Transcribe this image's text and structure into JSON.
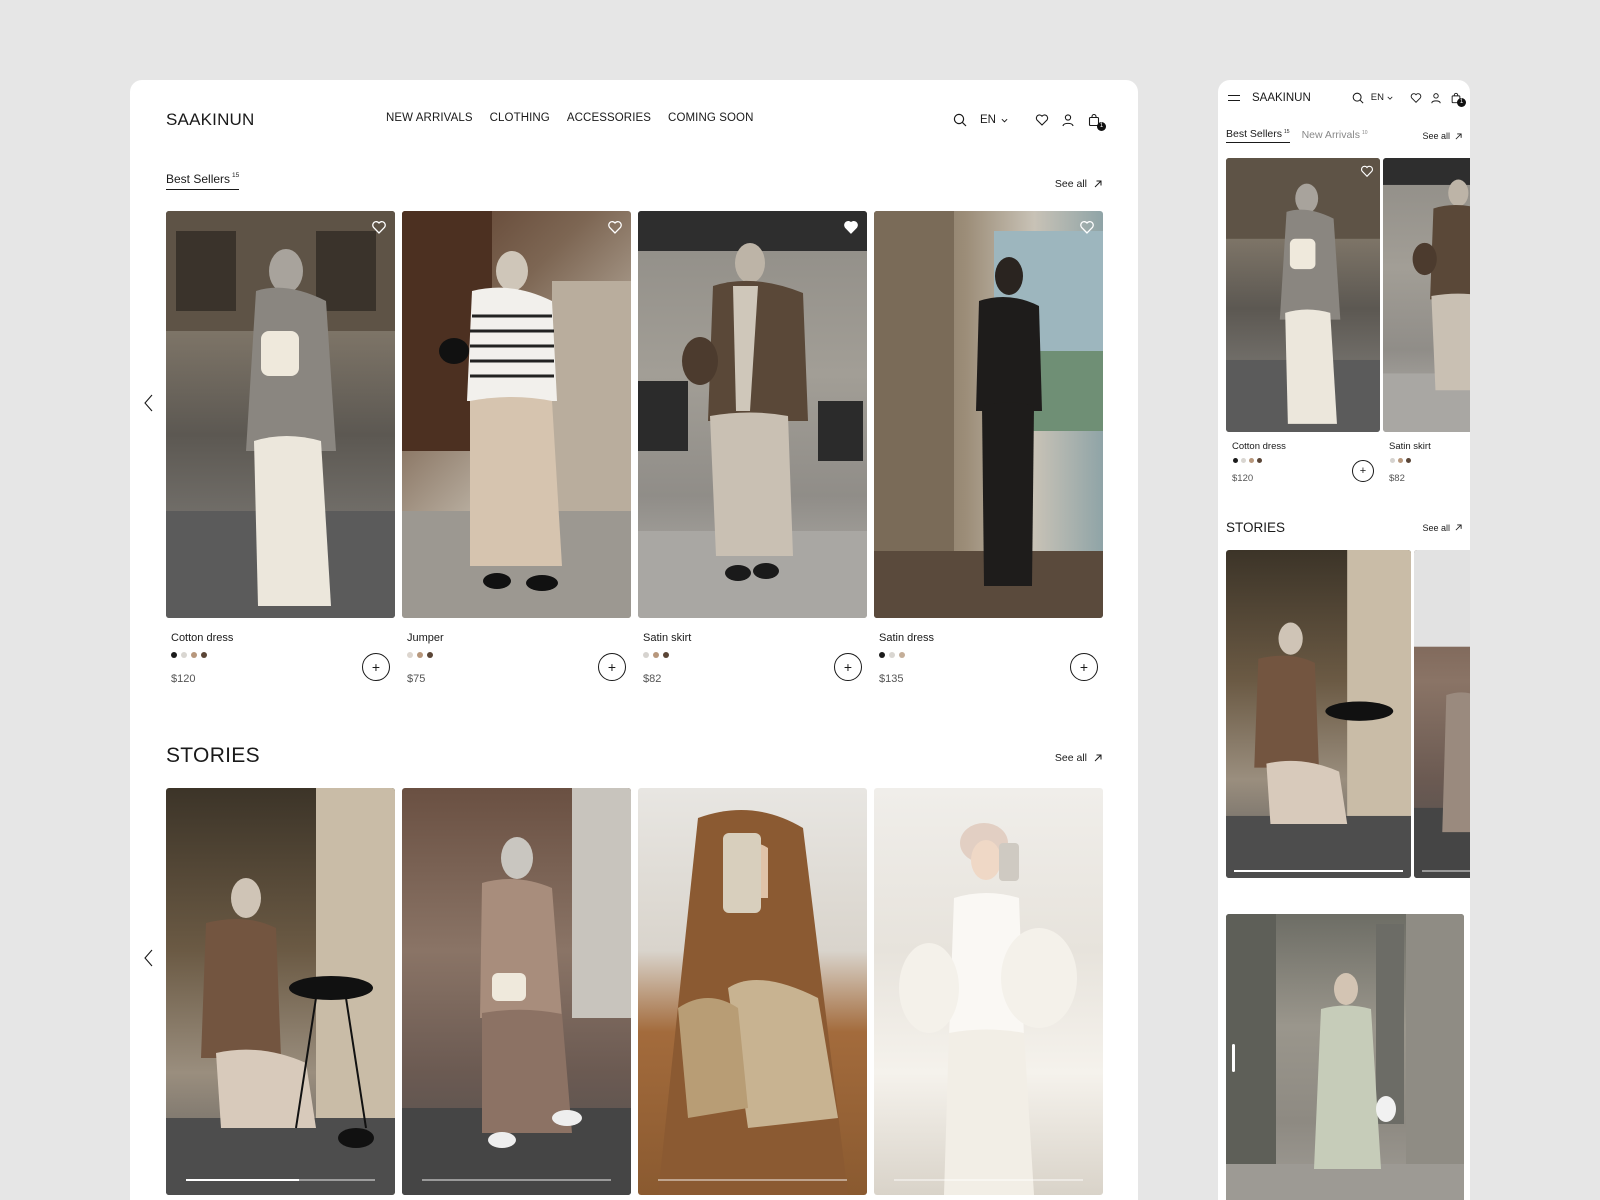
{
  "brand": "SAAKINUN",
  "nav": [
    "NEW ARRIVALS",
    "CLOTHING",
    "ACCESSORIES",
    "COMING SOON"
  ],
  "language": "EN",
  "cart_count": "1",
  "best_sellers": {
    "label": "Best Sellers",
    "count": "15",
    "see_all": "See all",
    "products": [
      {
        "name": "Cotton dress",
        "price": "$120",
        "swatches": [
          "#1b1b1b",
          "#d9d6d1",
          "#b7977c",
          "#5a4536"
        ]
      },
      {
        "name": "Jumper",
        "price": "$75",
        "swatches": [
          "#ddd6cf",
          "#b7977c",
          "#5a4536"
        ]
      },
      {
        "name": "Satin skirt",
        "price": "$82",
        "swatches": [
          "#d6d3cf",
          "#b7977c",
          "#5a4536"
        ]
      },
      {
        "name": "Satin dress",
        "price": "$135",
        "swatches": [
          "#1b1b1b",
          "#d9d6d1",
          "#c4ae98"
        ]
      }
    ]
  },
  "stories": {
    "title": "STORIES",
    "see_all": "See all"
  },
  "mobile": {
    "brand": "SAAKINUN",
    "language": "EN",
    "cart_count": "1",
    "tabs": [
      {
        "label": "Best Sellers",
        "count": "15"
      },
      {
        "label": "New Arrivals",
        "count": "10"
      }
    ],
    "see_all": "See all",
    "products": [
      {
        "name": "Cotton dress",
        "price": "$120",
        "swatches": [
          "#1b1b1b",
          "#d9d6d1",
          "#b7977c",
          "#5a4536"
        ]
      },
      {
        "name": "Satin skirt",
        "price": "$82",
        "swatches": [
          "#d6d3cf",
          "#b7977c",
          "#5a4536"
        ]
      }
    ],
    "stories_title": "STORIES",
    "stories_see_all": "See all"
  },
  "icons": {
    "search": "search-icon",
    "heart": "heart-icon",
    "user": "user-icon",
    "bag": "shopping-bag-icon",
    "menu": "hamburger-menu-icon",
    "arrow": "arrow-up-right-icon",
    "prev": "chevron-left-icon",
    "next": "chevron-right-icon"
  }
}
